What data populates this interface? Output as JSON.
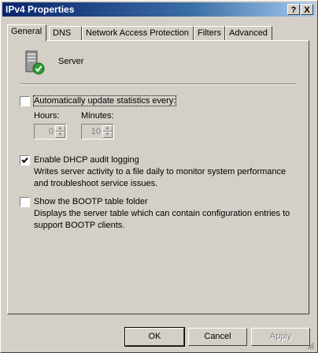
{
  "window": {
    "title": "IPv4 Properties"
  },
  "titlebar": {
    "help_label": "?",
    "close_label": "X"
  },
  "tabs": [
    {
      "label": "General"
    },
    {
      "label": "DNS"
    },
    {
      "label": "Network Access Protection"
    },
    {
      "label": "Filters"
    },
    {
      "label": "Advanced"
    }
  ],
  "server": {
    "label": "Server",
    "icon": "server-check-icon"
  },
  "auto_update": {
    "label": "Automatically update statistics every:",
    "checked": false,
    "hours_label": "Hours:",
    "hours_value": "0",
    "minutes_label": "Minutes:",
    "minutes_value": "10"
  },
  "dhcp_audit": {
    "label": "Enable DHCP audit logging",
    "checked": true,
    "description": "Writes server activity to a file daily to monitor system performance and troubleshoot service issues."
  },
  "bootp": {
    "label": "Show the BOOTP table folder",
    "checked": false,
    "description": "Displays the server table which can contain configuration entries to support BOOTP clients."
  },
  "buttons": {
    "ok": "OK",
    "cancel": "Cancel",
    "apply": "Apply"
  }
}
